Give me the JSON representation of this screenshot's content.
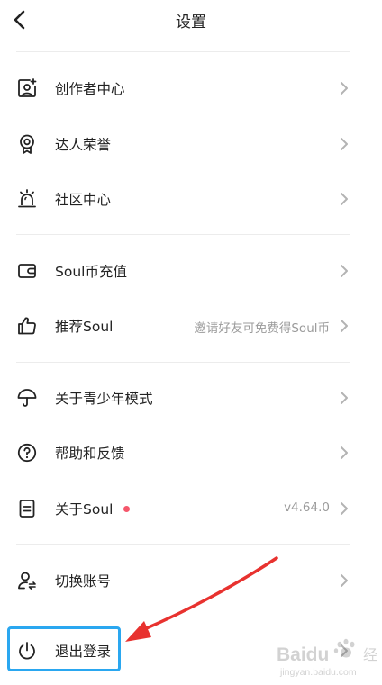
{
  "header": {
    "title": "设置"
  },
  "items": [
    {
      "label": "创作者中心"
    },
    {
      "label": "达人荣誉"
    },
    {
      "label": "社区中心"
    },
    {
      "label": "Soul币充值"
    },
    {
      "label": "推荐Soul",
      "hint": "邀请好友可免费得Soul币"
    },
    {
      "label": "关于青少年模式"
    },
    {
      "label": "帮助和反馈"
    },
    {
      "label": "关于Soul",
      "hint": "v4.64.0"
    },
    {
      "label": "切换账号"
    },
    {
      "label": "退出登录"
    }
  ],
  "watermark": {
    "brand": "Baidu",
    "sub": "jingyan.baidu.com"
  },
  "colors": {
    "highlight": "#2aa7f0",
    "arrow": "#e8322f",
    "badge": "#f5576b"
  }
}
